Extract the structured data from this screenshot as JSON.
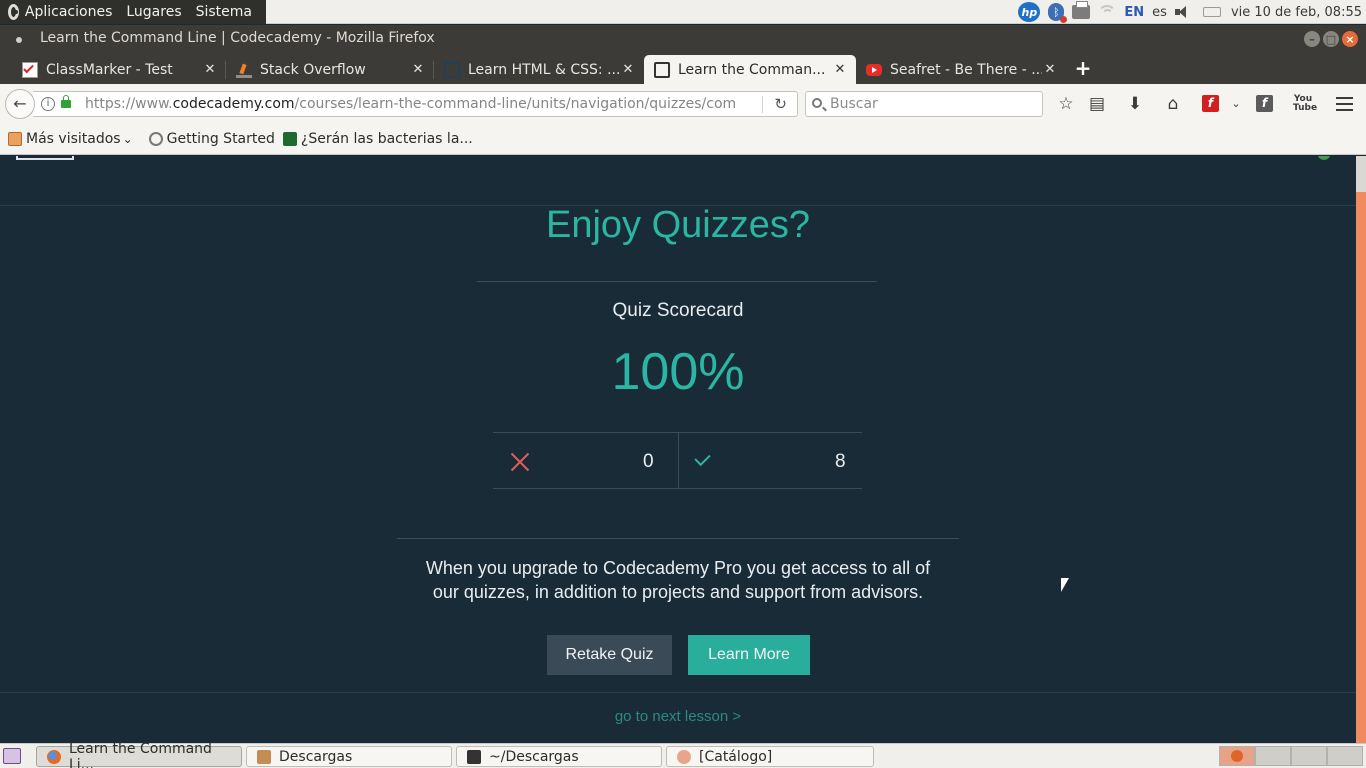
{
  "system_panel": {
    "menus": [
      "Aplicaciones",
      "Lugares",
      "Sistema"
    ],
    "tray": {
      "hp_label": "hp",
      "keyboard_layout": "EN",
      "language": "es",
      "clock": "vie 10 de feb, 08:55"
    }
  },
  "window": {
    "title": "Learn the Command Line | Codecademy - Mozilla Firefox"
  },
  "tabs": [
    {
      "label": "ClassMarker - Test",
      "icon": "checkbox-icon",
      "active": false
    },
    {
      "label": "Stack Overflow",
      "icon": "stackoverflow-icon",
      "active": false
    },
    {
      "label": "Learn HTML & CSS: ...",
      "icon": "codecademy-icon",
      "active": false
    },
    {
      "label": "Learn the Comman...",
      "icon": "codecademy-icon",
      "active": true
    },
    {
      "label": "Seafret - Be There - ...",
      "icon": "youtube-icon",
      "active": false
    }
  ],
  "navbar": {
    "url_scheme": "https://www.",
    "url_host": "codecademy.com",
    "url_path": "/courses/learn-the-command-line/units/navigation/quizzes/com",
    "search_placeholder": "Buscar"
  },
  "bookmarks": [
    {
      "label": "Más visitados",
      "icon": "folder-icon"
    },
    {
      "label": "Getting Started",
      "icon": "globe-icon"
    },
    {
      "label": "¿Serán las bacterias la...",
      "icon": "bacteria-icon"
    }
  ],
  "page": {
    "title": "Enjoy Quizzes?",
    "scorecard_label": "Quiz Scorecard",
    "score_percent": "100%",
    "wrong_count": "0",
    "right_count": "8",
    "upgrade_line1": "When you upgrade to Codecademy Pro you get access to all of",
    "upgrade_line2": "our quizzes, in addition to projects and support from advisors.",
    "retake_label": "Retake Quiz",
    "learn_more_label": "Learn More",
    "next_lesson_label": "go to next lesson >"
  },
  "taskbar": [
    {
      "label": "Learn the Command Li...",
      "icon": "firefox-icon",
      "active": true
    },
    {
      "label": "Descargas",
      "icon": "folder-icon",
      "active": false
    },
    {
      "label": "~/Descargas",
      "icon": "terminal-icon",
      "active": false
    },
    {
      "label": "[Catálogo]",
      "icon": "app-icon",
      "active": false
    }
  ],
  "colors": {
    "page_bg": "#1a2b38",
    "accent_teal": "#2bb5a2",
    "wrong_red": "#e25b5b"
  }
}
